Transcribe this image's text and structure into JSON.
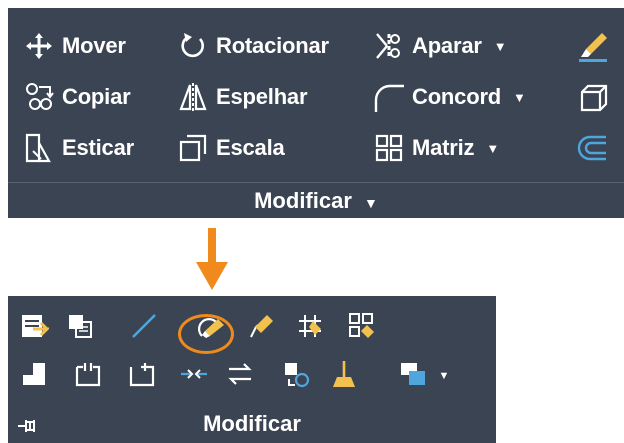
{
  "top_panel": {
    "rows": [
      [
        {
          "label": "Mover",
          "icon": "move-icon"
        },
        {
          "label": "Rotacionar",
          "icon": "rotate-icon"
        },
        {
          "label": "Aparar",
          "icon": "trim-icon",
          "dropdown": true
        },
        {
          "label": "",
          "icon": "erase-icon"
        }
      ],
      [
        {
          "label": "Copiar",
          "icon": "copy-icon"
        },
        {
          "label": "Espelhar",
          "icon": "mirror-icon"
        },
        {
          "label": "Concord",
          "icon": "fillet-icon",
          "dropdown": true
        },
        {
          "label": "",
          "icon": "3d-box-icon"
        }
      ],
      [
        {
          "label": "Esticar",
          "icon": "stretch-icon"
        },
        {
          "label": "Escala",
          "icon": "scale-icon"
        },
        {
          "label": "Matriz",
          "icon": "array-icon",
          "dropdown": true
        },
        {
          "label": "",
          "icon": "offset-icon"
        }
      ]
    ],
    "title": "Modificar",
    "title_caret": "▼"
  },
  "bottom_panel": {
    "title": "Modificar",
    "rows": [
      [
        "properties-edit-icon",
        "match-icon",
        "line-edit-icon",
        "erase-highlighted-icon",
        "pen-edit-icon",
        "grid-edit-icon",
        "array-edit-icon"
      ],
      [
        "block-icon",
        "frame-icon",
        "frame-alt-icon",
        "join-icon",
        "swap-icon",
        "edit-component-icon",
        "brush-icon",
        "layer-order-icon"
      ]
    ]
  },
  "colors": {
    "panel_bg": "#3b4453",
    "accent_orange": "#f08a1c",
    "icon_blue": "#4ea6dc",
    "icon_yellow": "#f2c14e"
  }
}
